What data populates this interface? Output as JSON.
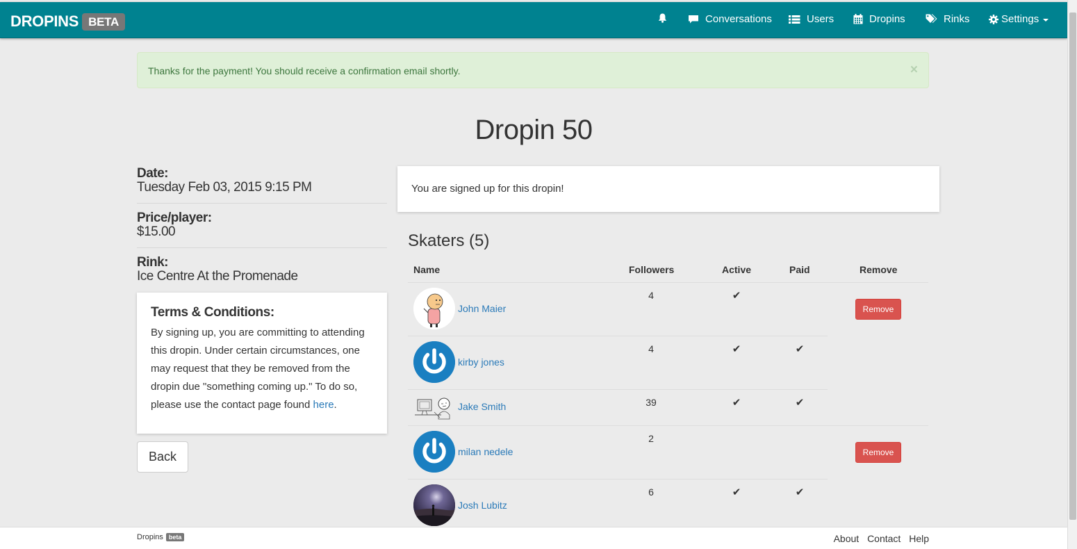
{
  "nav": {
    "brand": "DROPINS",
    "brand_badge": "BETA",
    "items": [
      {
        "label": "",
        "icon": "bell-icon"
      },
      {
        "label": "Conversations",
        "icon": "comment-icon"
      },
      {
        "label": "Users",
        "icon": "list-icon"
      },
      {
        "label": "Dropins",
        "icon": "calendar-icon"
      },
      {
        "label": "Rinks",
        "icon": "tags-icon"
      },
      {
        "label": "Settings",
        "icon": "gear-icon"
      }
    ],
    "color": "#008290"
  },
  "alert": {
    "message": "Thanks for the payment! You should receive a confirmation email shortly.",
    "close": "×"
  },
  "page": {
    "title": "Dropin 50"
  },
  "details": {
    "date_label": "Date:",
    "date_value": "Tuesday Feb 03, 2015 9:15 PM",
    "price_label": "Price/player:",
    "price_value": "$15.00",
    "rink_label": "Rink:",
    "rink_value": "Ice Centre At the Promenade"
  },
  "terms": {
    "title": "Terms & Conditions:",
    "body": "By signing up, you are committing to attending this dropin. Under certain circumstances, one may request that they be removed from the dropin due \"something coming up.\" To do so, please use the contact page found ",
    "link": "here",
    "end": "."
  },
  "back_label": "Back",
  "signup_status": "You are signed up for this dropin!",
  "skaters": {
    "heading": "Skaters (5)",
    "columns": [
      "Name",
      "Followers",
      "Active",
      "Paid",
      "Remove"
    ],
    "remove_label": "Remove",
    "check": "✔",
    "rows": [
      {
        "name": "John Maier",
        "followers": "4",
        "active": true,
        "paid": false,
        "removable": true,
        "avatar": "cartoon-avatar"
      },
      {
        "name": "kirby jones",
        "followers": "4",
        "active": true,
        "paid": true,
        "removable": false,
        "avatar": "power-avatar"
      },
      {
        "name": "Jake Smith",
        "followers": "39",
        "active": true,
        "paid": true,
        "removable": false,
        "avatar": "sketch-avatar"
      },
      {
        "name": "milan nedele",
        "followers": "2",
        "active": false,
        "paid": false,
        "removable": true,
        "avatar": "power-avatar"
      },
      {
        "name": "Josh Lubitz",
        "followers": "6",
        "active": true,
        "paid": true,
        "removable": false,
        "avatar": "photo-avatar"
      }
    ]
  },
  "footer": {
    "brand": "Dropins",
    "badge": "beta",
    "links": [
      "About",
      "Contact",
      "Help"
    ]
  }
}
